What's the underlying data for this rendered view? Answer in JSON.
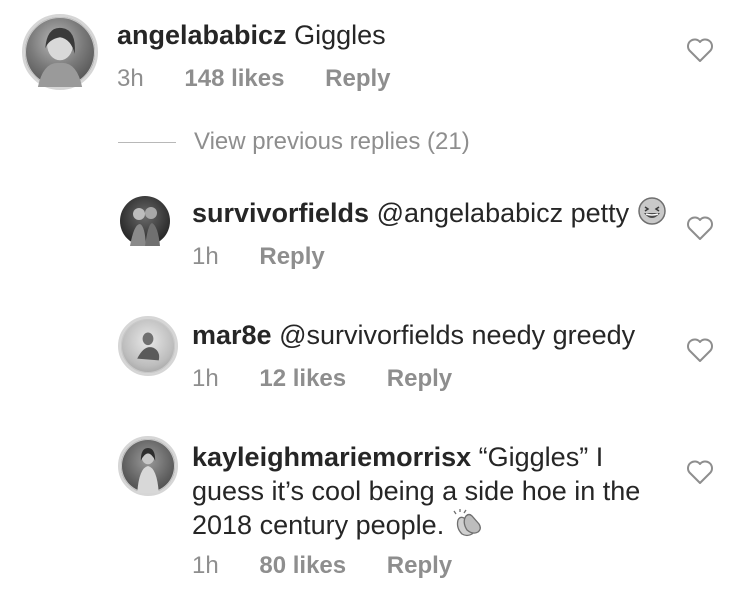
{
  "comments": [
    {
      "username": "angelababicz",
      "text": " Giggles",
      "time": "3h",
      "likes": "148 likes",
      "reply": "Reply"
    }
  ],
  "view_previous": "View previous replies (21)",
  "replies": [
    {
      "username": "survivorfields",
      "text": " @angelababicz petty ",
      "emoji": "laughing-face-icon",
      "time": "1h",
      "reply": "Reply"
    },
    {
      "username": "mar8e",
      "text": " @survivorfields needy greedy",
      "time": "1h",
      "likes": "12 likes",
      "reply": "Reply"
    },
    {
      "username": "kayleighmariemorrisx",
      "text_line1": " “Giggles” I",
      "text_line2": "guess it’s cool being a side hoe in the",
      "text_line3": "2018 century people. ",
      "emoji": "clapping-hands-icon",
      "time": "1h",
      "likes": "80 likes",
      "reply": "Reply"
    }
  ],
  "colors": {
    "text": "#262626",
    "meta": "#8e8e8e",
    "divider": "#b8b8b8"
  }
}
